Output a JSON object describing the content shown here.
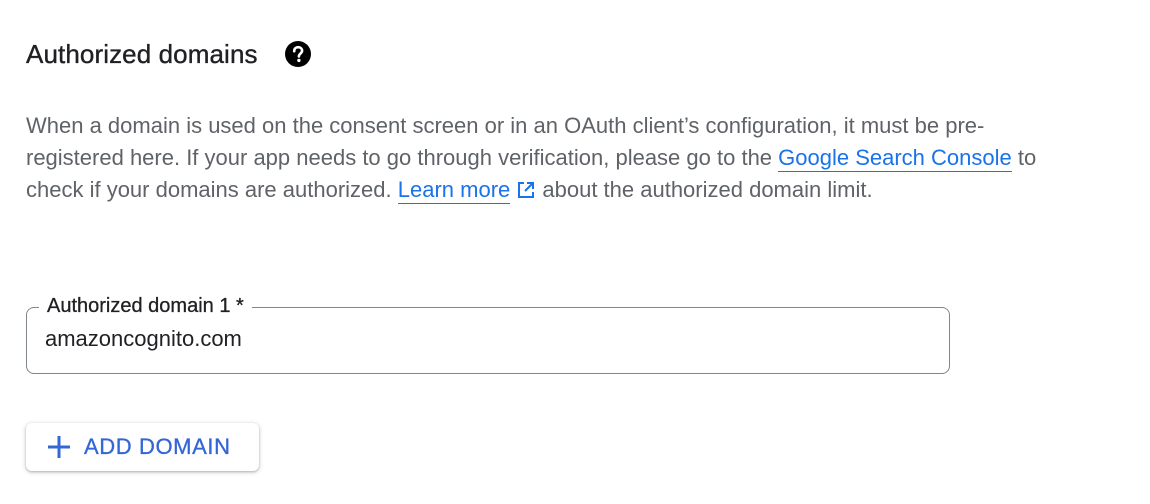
{
  "section": {
    "title": "Authorized domains",
    "help_icon": "help-circle-icon"
  },
  "description": {
    "text_1": "When a domain is used on the consent screen or in an OAuth client’s configuration, it must be pre-registered here. If your app needs to go through verification, please go to the ",
    "link_search_console": "Google Search Console",
    "text_2": " to check if your domains are authorized. ",
    "link_learn_more": "Learn more",
    "external_icon": "open-in-new-icon",
    "text_3": " about the authorized domain limit."
  },
  "domain_field": {
    "label": "Authorized domain 1 *",
    "value": "amazoncognito.com"
  },
  "add_button": {
    "icon": "plus-icon",
    "label": "ADD DOMAIN"
  },
  "colors": {
    "link": "#1a73e8",
    "button_text": "#3367d6",
    "body_text": "#5f6368",
    "heading": "#202124",
    "field_border": "#80868b"
  }
}
